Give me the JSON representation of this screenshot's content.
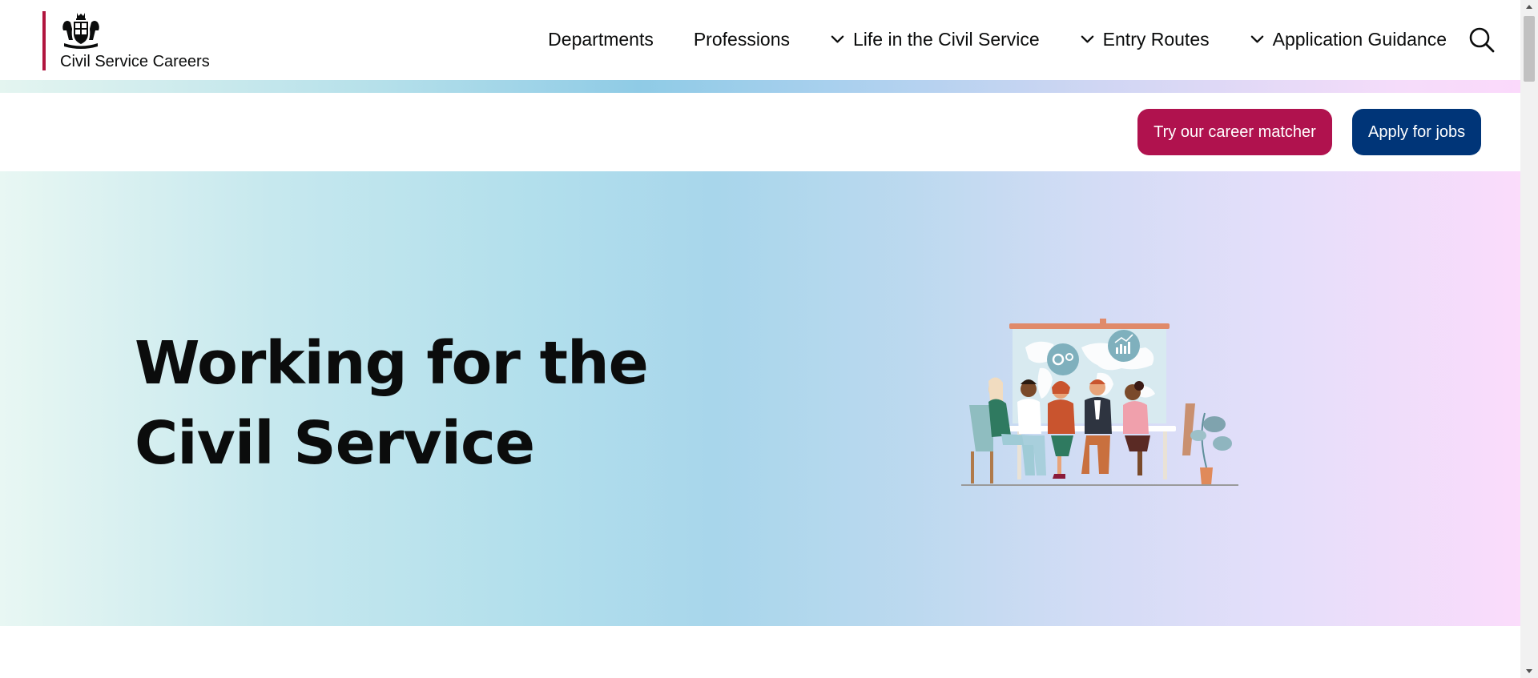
{
  "header": {
    "logo_text": "Civil Service Careers",
    "nav": [
      {
        "label": "Departments",
        "dropdown": false
      },
      {
        "label": "Professions",
        "dropdown": false
      },
      {
        "label": "Life in the Civil Service",
        "dropdown": true
      },
      {
        "label": "Entry Routes",
        "dropdown": true
      },
      {
        "label": "Application Guidance",
        "dropdown": true
      }
    ],
    "icons": {
      "logo": "royal-crest-icon",
      "dropdown": "chevron-down-icon",
      "search": "search-icon"
    }
  },
  "cta": {
    "matcher_label": "Try our career matcher",
    "apply_label": "Apply for jobs"
  },
  "hero": {
    "title_line1": "Working for the",
    "title_line2": "Civil Service"
  },
  "colors": {
    "brand_red": "#b1153e",
    "matcher_button": "#b0124e",
    "apply_button": "#003578",
    "text": "#0b0c0c"
  }
}
